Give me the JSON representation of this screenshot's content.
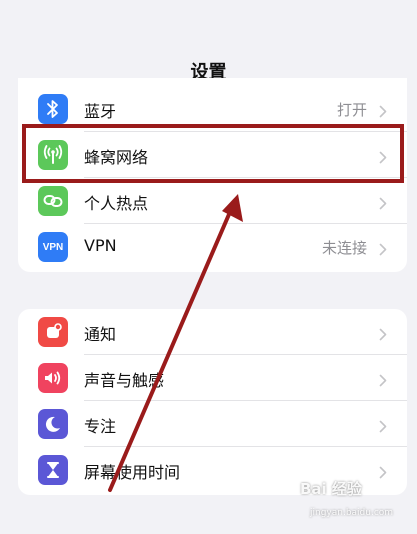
{
  "header": {
    "title": "设置"
  },
  "group1": {
    "rows": [
      {
        "label": "蓝牙",
        "value": "打开",
        "icon": "bluetooth-icon",
        "icon_color": "#2f7cf6"
      },
      {
        "label": "蜂窝网络",
        "value": "",
        "icon": "cellular-antenna-icon",
        "icon_color": "#5cc85a"
      },
      {
        "label": "个人热点",
        "value": "",
        "icon": "hotspot-link-icon",
        "icon_color": "#5cc85a"
      },
      {
        "label": "VPN",
        "value": "未连接",
        "icon": "vpn-icon",
        "icon_text": "VPN",
        "icon_color": "#2f7cf6"
      }
    ]
  },
  "group2": {
    "rows": [
      {
        "label": "通知",
        "icon": "notification-bell-icon",
        "icon_color": "#f04a45"
      },
      {
        "label": "声音与触感",
        "icon": "speaker-icon",
        "icon_color": "#f0435f"
      },
      {
        "label": "专注",
        "icon": "moon-icon",
        "icon_color": "#5b57d6"
      },
      {
        "label": "屏幕使用时间",
        "icon": "hourglass-icon",
        "icon_color": "#5b57d6"
      }
    ]
  },
  "annotation": {
    "highlight_color": "#9a1b1b"
  },
  "watermark": {
    "text": "Bai 经验",
    "sub": "jingyan.baidu.com"
  }
}
